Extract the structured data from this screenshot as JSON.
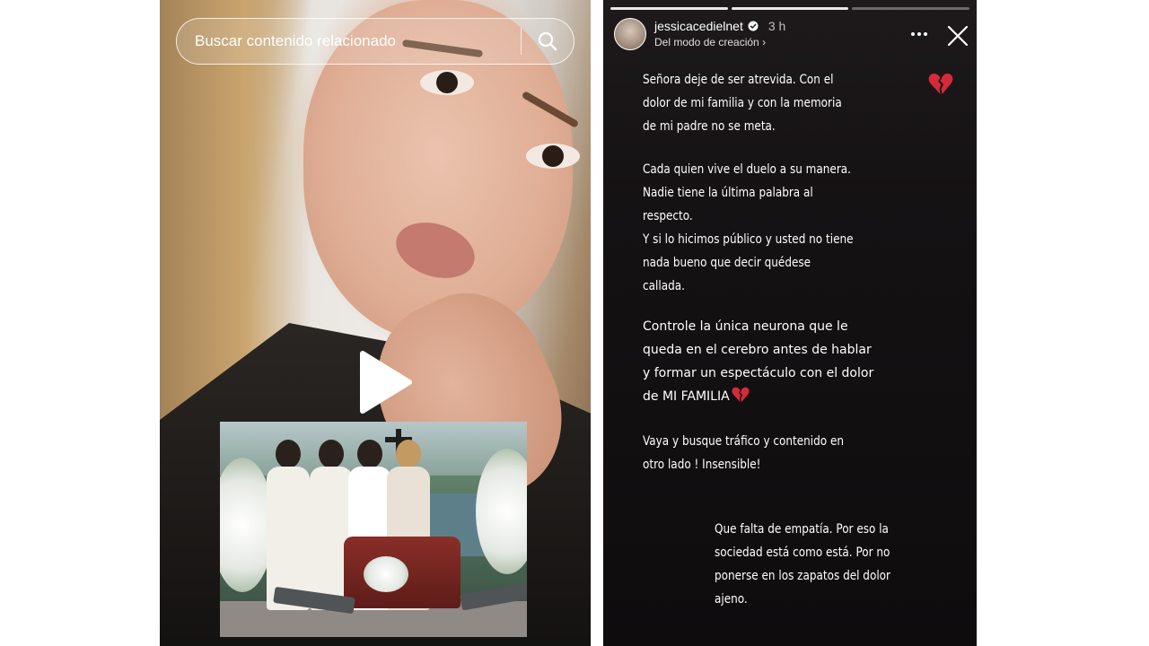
{
  "search": {
    "placeholder": "Buscar contenido relacionado"
  },
  "story": {
    "username": "jessicacedielnet",
    "time": "3 h",
    "subtitle": "Del modo de creación ›",
    "paragraphs": [
      "Señora deje de ser atrevida. Con el\ndolor de mi familia y con la memoria\nde mi padre no se meta.",
      "Cada quien vive el duelo a su manera.\nNadie tiene la última palabra al\nrespecto.\nY si lo hicimos público y usted no tiene\nnada bueno que decir quédese\ncallada.",
      "Controle la única neurona que le\nqueda en el cerebro antes de hablar\ny formar un espectáculo con el dolor\nde MI FAMILIA",
      "Vaya y busque tráfico y contenido en\notro lado ! Insensible!",
      "Que falta de empatía. Por eso la\nsociedad está como está. Por no\nponerse en los zapatos del dolor\najeno."
    ]
  },
  "icons": [
    "search-icon",
    "play-icon",
    "verified-badge-icon",
    "more-options-icon",
    "close-icon",
    "broken-heart-icon"
  ],
  "colors": {
    "heart": "#d42a3a",
    "story_bg": "#151214"
  }
}
